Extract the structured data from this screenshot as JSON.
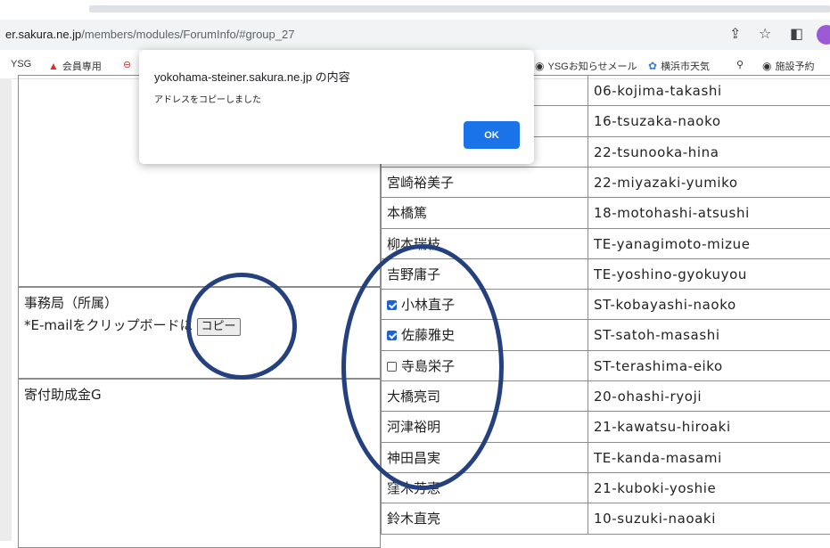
{
  "browser": {
    "url_host": "er.sakura.ne.jp",
    "url_path": "/members/modules/ForumInfo/#group_27",
    "bookmarks": [
      {
        "label": "YSG",
        "icon": ""
      },
      {
        "label": "会員専用",
        "icon": "red-swirl-icon"
      },
      {
        "label": "YSGお知らせメール",
        "icon": "globe-icon"
      },
      {
        "label": "横浜市天気",
        "icon": "weather-icon"
      },
      {
        "label": "施設予約",
        "icon": "globe-icon"
      }
    ]
  },
  "dialog": {
    "title": "yokohama-steiner.sakura.ne.jp の内容",
    "message": "アドレスをコピーしました",
    "ok_label": "OK"
  },
  "groups": [
    {
      "title": "事務局（所属）",
      "subtitle": "*E-mailをクリップボードに",
      "copy_label": "コピー"
    },
    {
      "title": "寄付助成金G"
    }
  ],
  "rows": [
    {
      "name": "",
      "email": "06-kojima-takashi"
    },
    {
      "name": "",
      "email": "16-tsuzaka-naoko"
    },
    {
      "name": "",
      "email": "22-tsunooka-hina"
    },
    {
      "name": "宮崎裕美子",
      "email": "22-miyazaki-yumiko"
    },
    {
      "name": "本橋篤",
      "email": "18-motohashi-atsushi"
    },
    {
      "name": "柳本瑞枝",
      "email": "TE-yanagimoto-mizue"
    },
    {
      "name": "吉野庸子",
      "email": "TE-yoshino-gyokuyou"
    },
    {
      "name": "小林直子",
      "email": "ST-kobayashi-naoko",
      "checked": true
    },
    {
      "name": "佐藤雅史",
      "email": "ST-satoh-masashi",
      "checked": true
    },
    {
      "name": "寺島栄子",
      "email": "ST-terashima-eiko",
      "checked": false
    },
    {
      "name": "大橋亮司",
      "email": "20-ohashi-ryoji"
    },
    {
      "name": "河津裕明",
      "email": "21-kawatsu-hiroaki"
    },
    {
      "name": "神田昌実",
      "email": "TE-kanda-masami"
    },
    {
      "name": "窪木芳恵",
      "email": "21-kuboki-yoshie"
    },
    {
      "name": "鈴木直亮",
      "email": "10-suzuki-naoaki"
    }
  ]
}
